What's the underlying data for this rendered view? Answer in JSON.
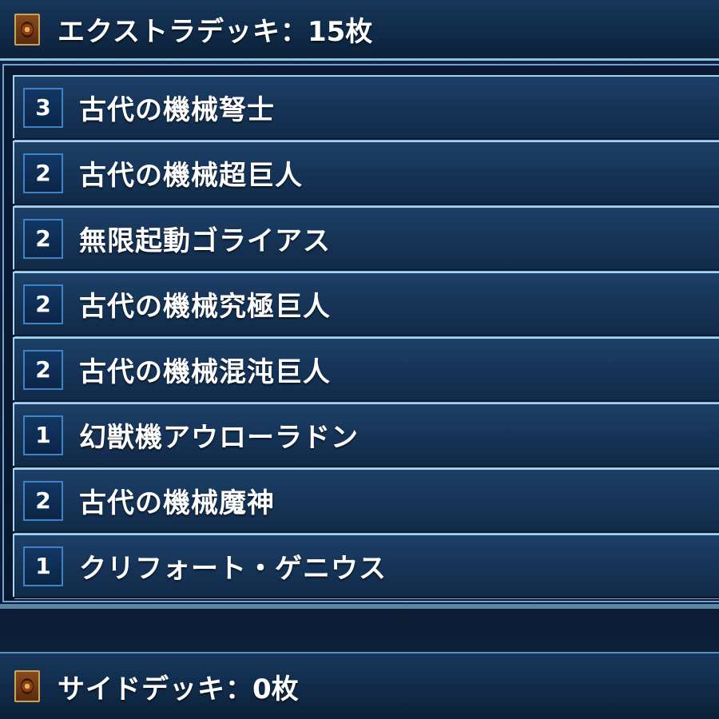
{
  "extra_deck": {
    "title": "エクストラデッキ",
    "count_label": "：15枚",
    "cards": [
      {
        "qty": "3",
        "name": "古代の機械弩士"
      },
      {
        "qty": "2",
        "name": "古代の機械超巨人"
      },
      {
        "qty": "2",
        "name": "無限起動ゴライアス"
      },
      {
        "qty": "2",
        "name": "古代の機械究極巨人"
      },
      {
        "qty": "2",
        "name": "古代の機械混沌巨人"
      },
      {
        "qty": "1",
        "name": "幻獣機アウローラドン"
      },
      {
        "qty": "2",
        "name": "古代の機械魔神"
      },
      {
        "qty": "1",
        "name": "クリフォート・ゲニウス"
      }
    ]
  },
  "side_deck": {
    "title": "サイドデッキ",
    "count_label": "：0枚"
  },
  "icons": {
    "section_icon": "card-back-icon"
  }
}
